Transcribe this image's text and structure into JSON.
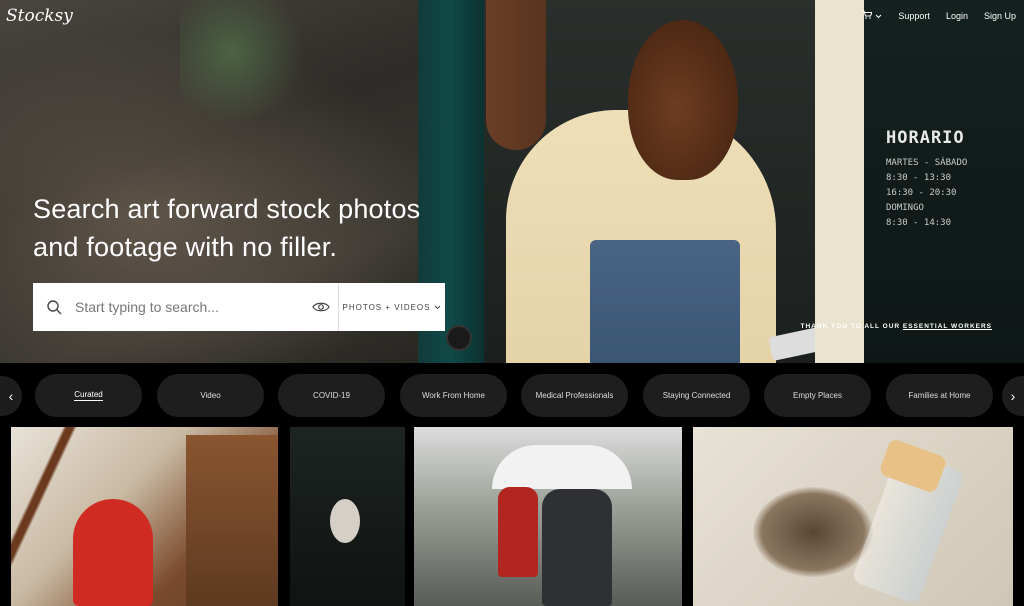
{
  "header": {
    "logo": "Stocksy",
    "nav": {
      "support": "Support",
      "login": "Login",
      "signup": "Sign Up"
    }
  },
  "hero": {
    "headline_line1": "Search art forward stock photos",
    "headline_line2": "and footage with no filler.",
    "search": {
      "placeholder": "Start typing to search...",
      "type_label": "PHOTOS + VIDEOS"
    },
    "essential": {
      "prefix": "THANK YOU TO ALL OUR ",
      "link": "ESSENTIAL WORKERS"
    },
    "chalkboard": {
      "title": "HORARIO",
      "lines": [
        "MARTES - SÁBADO",
        "8:30 - 13:30",
        "16:30 - 20:30",
        "DOMINGO",
        "8:30 - 14:30"
      ]
    }
  },
  "categories": [
    {
      "label": "Curated",
      "active": true
    },
    {
      "label": "Video"
    },
    {
      "label": "COVID-19"
    },
    {
      "label": "Work From Home"
    },
    {
      "label": "Medical Professionals"
    },
    {
      "label": "Staying Connected"
    },
    {
      "label": "Empty Places"
    },
    {
      "label": "Families at Home"
    }
  ],
  "icons": {
    "cart": "cart-icon",
    "search": "search-icon",
    "visual_search": "eye-icon",
    "prev": "chevron-left-icon",
    "next": "chevron-right-icon"
  },
  "colors": {
    "accent": "#ffffff",
    "pill_bg": "#1e1e1e",
    "page_bg": "#000000"
  }
}
